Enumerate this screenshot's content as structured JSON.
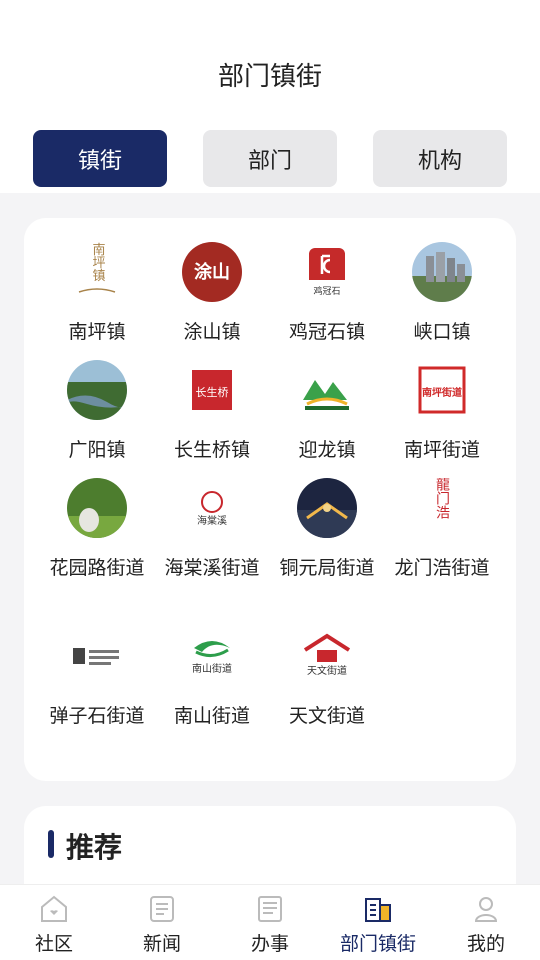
{
  "header": {
    "title": "部门镇街"
  },
  "tabs": [
    {
      "label": "镇街",
      "active": true
    },
    {
      "label": "部门",
      "active": false
    },
    {
      "label": "机构",
      "active": false
    }
  ],
  "grid": {
    "items": [
      {
        "label": "南坪镇",
        "logo_text": "南坪镇",
        "icon": "nanping-town-logo"
      },
      {
        "label": "涂山镇",
        "logo_text": "涂山",
        "icon": "tushan-town-logo"
      },
      {
        "label": "鸡冠石镇",
        "logo_text": "鸡冠石",
        "icon": "jiguanshi-town-logo"
      },
      {
        "label": "峡口镇",
        "icon": "xiakou-town-photo"
      },
      {
        "label": "广阳镇",
        "icon": "guangyang-town-photo"
      },
      {
        "label": "长生桥镇",
        "logo_text": "长生桥",
        "icon": "changshengqiao-town-logo"
      },
      {
        "label": "迎龙镇",
        "icon": "yinglong-town-logo"
      },
      {
        "label": "南坪街道",
        "logo_text": "南坪街道",
        "icon": "nanping-street-logo"
      },
      {
        "label": "花园路街道",
        "icon": "huayuanlu-street-photo"
      },
      {
        "label": "海棠溪街道",
        "logo_text": "海棠溪",
        "icon": "haitangxi-street-logo"
      },
      {
        "label": "铜元局街道",
        "icon": "tongyuanju-street-photo"
      },
      {
        "label": "龙门浩街道",
        "logo_text": "龍门浩",
        "icon": "longmenhao-street-logo"
      },
      {
        "label": "弹子石街道",
        "icon": "danzishi-street-logo"
      },
      {
        "label": "南山街道",
        "logo_text": "南山街道",
        "icon": "nanshan-street-logo"
      },
      {
        "label": "天文街道",
        "logo_text": "天文街道",
        "icon": "tianwen-street-logo"
      }
    ]
  },
  "recommend": {
    "title": "推荐"
  },
  "bottom_nav": [
    {
      "label": "社区",
      "icon": "community-icon",
      "active": false
    },
    {
      "label": "新闻",
      "icon": "news-icon",
      "active": false
    },
    {
      "label": "办事",
      "icon": "services-icon",
      "active": false
    },
    {
      "label": "部门镇街",
      "icon": "departments-icon",
      "active": true
    },
    {
      "label": "我的",
      "icon": "profile-icon",
      "active": false
    }
  ],
  "colors": {
    "accent": "#1a2a66",
    "background": "#f4f4f6"
  }
}
